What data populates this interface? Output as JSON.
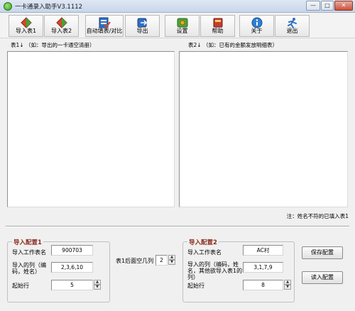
{
  "window": {
    "title": "一卡通录入助手V3.1112",
    "minimize": "—",
    "maximize": "□",
    "close": "✕"
  },
  "toolbar": {
    "import1": "导入表1",
    "import2": "导入表2",
    "autofill": "自动填表/对比",
    "export": "导出",
    "settings": "设置",
    "help": "帮助",
    "about": "关于",
    "exit": "退出"
  },
  "panels": {
    "left_caption": "表1↓ （如：导出的一卡通空清册）",
    "right_caption": "表2↓ （如：已有的金额发放明细表）"
  },
  "note": "注：姓名不符的已填入表1",
  "config1": {
    "title": "导入配置1",
    "sheet_label": "导入工作表名",
    "sheet_value": "900703",
    "cols_label": "导入的列（编码，姓名）",
    "cols_value": "2,3,6,10",
    "start_label": "起始行",
    "start_value": "5"
  },
  "middle": {
    "label": "表1后面空几列",
    "value": "2"
  },
  "config2": {
    "title": "导入配置2",
    "sheet_label": "导入工作表名",
    "sheet_value": "AC村",
    "cols_label": "导入的列（编码，姓名，其他欲导入表1的列）",
    "cols_value": "3,1,7,9",
    "start_label": "起始行",
    "start_value": "8"
  },
  "buttons": {
    "save": "保存配置",
    "load": "读入配置"
  },
  "spin_glyphs": {
    "up": "▲",
    "down": "▼"
  }
}
